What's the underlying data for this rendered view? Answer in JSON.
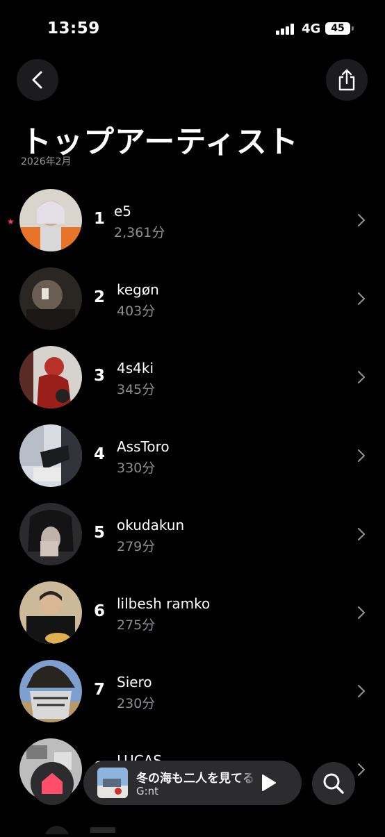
{
  "status_bar": {
    "time": "13:59",
    "network": "4G",
    "battery": "45"
  },
  "header": {
    "title": "トップアーティスト",
    "subtitle": "2026年2月",
    "back_icon": "chevron-left-icon",
    "share_icon": "share-icon"
  },
  "artists": [
    {
      "rank": "1",
      "name": "e5",
      "minutes": "2,361分",
      "starred": true
    },
    {
      "rank": "2",
      "name": "kegøn",
      "minutes": "403分"
    },
    {
      "rank": "3",
      "name": "4s4ki",
      "minutes": "345分"
    },
    {
      "rank": "4",
      "name": "AssToro",
      "minutes": "330分"
    },
    {
      "rank": "5",
      "name": "okudakun",
      "minutes": "279分"
    },
    {
      "rank": "6",
      "name": "lilbesh ramko",
      "minutes": "275分"
    },
    {
      "rank": "7",
      "name": "Siero",
      "minutes": "230分"
    },
    {
      "rank": "8",
      "name": "LUCAS",
      "minutes": ""
    }
  ],
  "now_playing": {
    "title": "冬の海も二人を見てる",
    "artist": "G:nt"
  },
  "colors": {
    "background": "#000000",
    "secondary_text": "#8e8e93",
    "accent": "#ff375f",
    "button_bg": "#2c2c2e"
  }
}
